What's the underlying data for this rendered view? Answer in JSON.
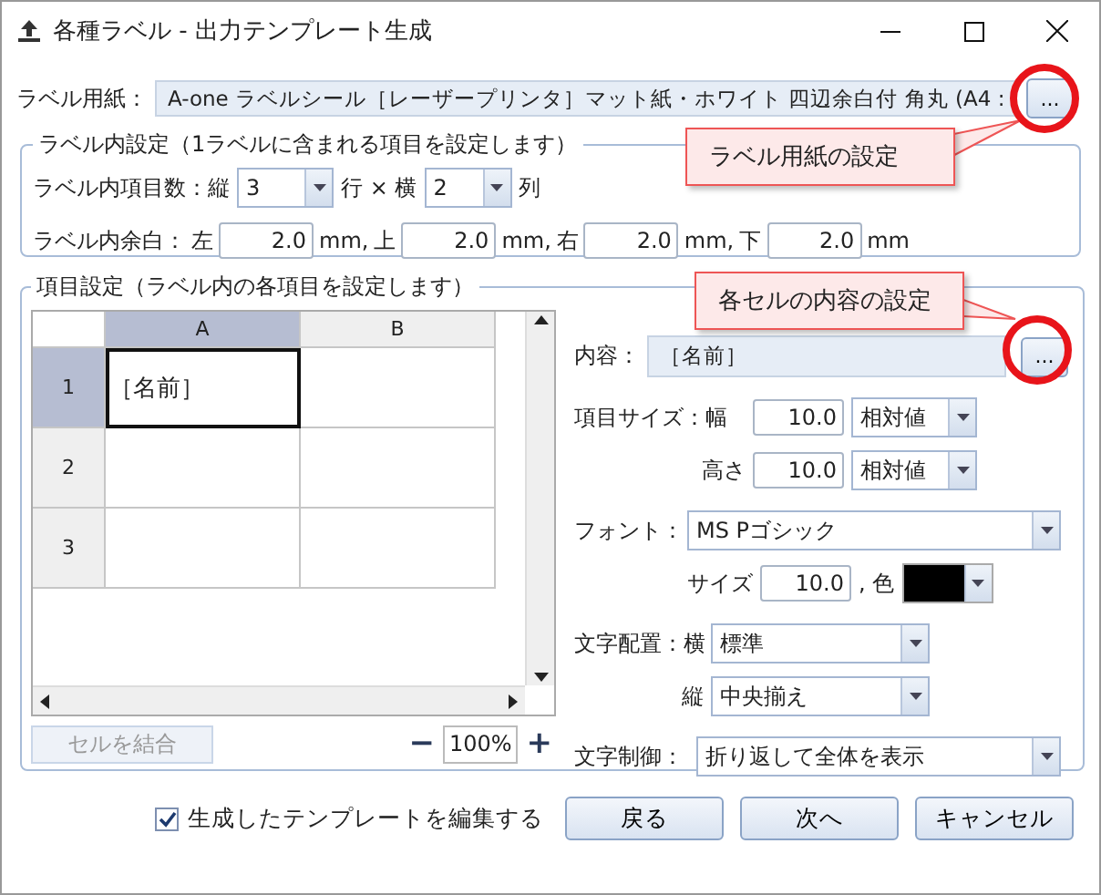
{
  "window": {
    "title": "各種ラベル - 出力テンプレート生成"
  },
  "label_paper": {
    "label": "ラベル用紙：",
    "value": "A-one ラベルシール［レーザープリンタ］マット紙・ホワイト 四辺余白付 角丸 (A4 :",
    "button": "..."
  },
  "label_settings": {
    "legend": "ラベル内設定（1ラベルに含まれる項目を設定します）",
    "count_label": "ラベル内項目数：縦",
    "rows": "3",
    "rows_unit": "行 × 横",
    "cols": "2",
    "cols_unit": "列",
    "margin_label": "ラベル内余白：",
    "margins": [
      {
        "side": "左",
        "value": "2.0",
        "unit": "mm,"
      },
      {
        "side": "上",
        "value": "2.0",
        "unit": "mm,"
      },
      {
        "side": "右",
        "value": "2.0",
        "unit": "mm,"
      },
      {
        "side": "下",
        "value": "2.0",
        "unit": "mm"
      }
    ]
  },
  "item_settings": {
    "legend": "項目設定（ラベル内の各項目を設定します）",
    "grid": {
      "columns": [
        {
          "label": "A",
          "selected": true
        },
        {
          "label": "B",
          "selected": false
        }
      ],
      "rows": [
        {
          "header": "1",
          "selected": true,
          "cells": [
            {
              "text": "［名前］",
              "selected": true
            },
            {
              "selected": false
            }
          ]
        },
        {
          "header": "2",
          "selected": false,
          "cells": [
            {
              "selected": false
            },
            {
              "selected": false
            }
          ]
        },
        {
          "header": "3",
          "selected": false,
          "cells": [
            {
              "selected": false
            },
            {
              "selected": false
            }
          ]
        }
      ]
    },
    "merge_button": {
      "label": "セルを結合",
      "disabled": true
    },
    "zoom": {
      "minus": "−",
      "value": "100%",
      "plus": "+"
    },
    "content": {
      "label": "内容：",
      "value": "［名前］",
      "button": "..."
    },
    "size_label": "項目サイズ：幅",
    "width": {
      "value": "10.0",
      "mode": "相対値"
    },
    "height_label": "高さ",
    "height": {
      "value": "10.0",
      "mode": "相対値"
    },
    "font_label": "フォント：",
    "font": "MS Pゴシック",
    "font_size_label": "サイズ",
    "font_size": "10.0",
    "color_label": ", 色",
    "color": "#000000",
    "align_label": "文字配置：横",
    "h_align": "標準",
    "v_align_label": "縦",
    "v_align": "中央揃え",
    "text_control_label": "文字制御：",
    "text_control": "折り返して全体を表示"
  },
  "footer": {
    "edit_checkbox": {
      "label": "生成したテンプレートを編集する",
      "checked": true
    },
    "buttons": [
      "戻る",
      "次へ",
      "キャンセル"
    ]
  },
  "callouts": [
    {
      "text": "ラベル用紙の設定"
    },
    {
      "text": "各セルの内容の設定"
    }
  ]
}
